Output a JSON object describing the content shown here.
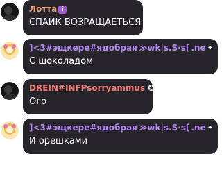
{
  "messages": [
    {
      "author": "Лотта",
      "author_color": "#f0a37a",
      "badge": "i",
      "text": "СПАЙК ВОЗРАЩАЕТЬСЯ"
    },
    {
      "author_part1": "]<3#эщкере#ядобрая",
      "author_part2": "≫wk|s.S·s[",
      "author_part3": ".ne",
      "author_color": "#b288f0",
      "text": "С шоколадом"
    },
    {
      "author": "DREIN#INFPsorryammus",
      "author_color": "#f07b74",
      "text": "Ого"
    },
    {
      "author_part1": "]<3#эщкере#ядобрая",
      "author_part2": "≫wk|s.S·s[",
      "author_part3": ".ne",
      "author_color": "#b288f0",
      "text": "И орешками"
    }
  ]
}
